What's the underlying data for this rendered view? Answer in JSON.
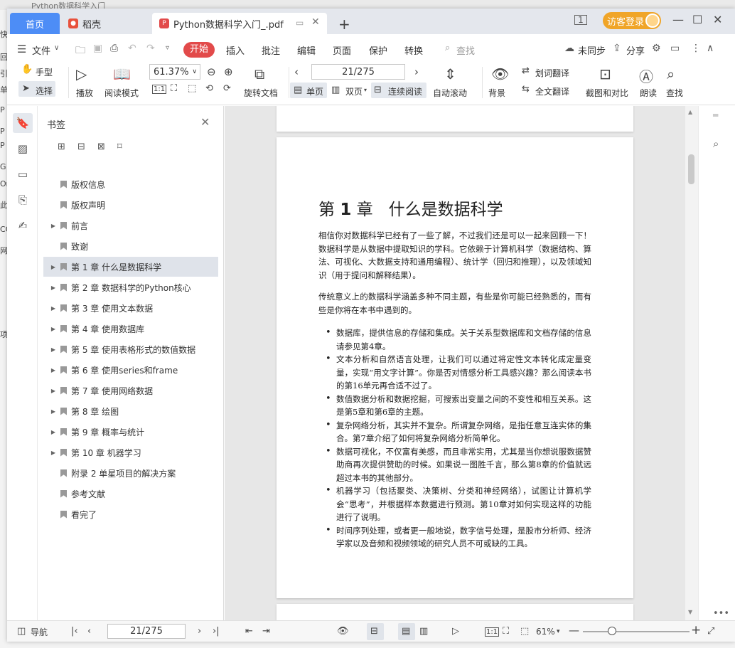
{
  "background": {
    "title": "Python数据科学入门",
    "left_glyphs": [
      "快",
      "回",
      "引",
      "单",
      "P",
      "P",
      "P",
      "G",
      "Or",
      "此",
      "CO",
      "网",
      "项"
    ]
  },
  "tabs": {
    "home": "首页",
    "daoke": "稻壳",
    "pdf": "Python数据科学入门_.pdf",
    "add": "+"
  },
  "account": {
    "login_label": "访客登录"
  },
  "window_controls": {
    "minimize": "—",
    "maximize": "☐",
    "close": "✕"
  },
  "menu": {
    "file": "文件",
    "start": "开始",
    "items": [
      "插入",
      "批注",
      "编辑",
      "页面",
      "保护",
      "转换"
    ],
    "search": "查找",
    "sync": "未同步",
    "share": "分享"
  },
  "ribbon": {
    "hand": "手型",
    "select": "选择",
    "play": "播放",
    "read_mode": "阅读模式",
    "zoom_value": "61.37%",
    "rotate_doc": "旋转文档",
    "page_value": "21/275",
    "single_page": "单页",
    "double_page": "双页",
    "continuous": "连续阅读",
    "auto_scroll": "自动滚动",
    "background": "背景",
    "word_translate": "划词翻译",
    "full_translate": "全文翻译",
    "screenshot_compare": "截图和对比",
    "read_aloud": "朗读",
    "find": "查找"
  },
  "bookmarks": {
    "title": "书签",
    "items": [
      {
        "label": "版权信息",
        "expandable": false,
        "selected": false
      },
      {
        "label": "版权声明",
        "expandable": false,
        "selected": false
      },
      {
        "label": "前言",
        "expandable": true,
        "selected": false
      },
      {
        "label": "致谢",
        "expandable": false,
        "selected": false
      },
      {
        "label": "第 1 章 什么是数据科学",
        "expandable": true,
        "selected": true
      },
      {
        "label": "第 2 章 数据科学的Python核心",
        "expandable": true,
        "selected": false
      },
      {
        "label": "第 3 章 使用文本数据",
        "expandable": true,
        "selected": false
      },
      {
        "label": "第 4 章 使用数据库",
        "expandable": true,
        "selected": false
      },
      {
        "label": "第 5 章 使用表格形式的数值数据",
        "expandable": true,
        "selected": false
      },
      {
        "label": "第 6 章 使用series和frame",
        "expandable": true,
        "selected": false
      },
      {
        "label": "第 7 章 使用网络数据",
        "expandable": true,
        "selected": false
      },
      {
        "label": "第 8 章 绘图",
        "expandable": true,
        "selected": false
      },
      {
        "label": "第 9 章 概率与统计",
        "expandable": true,
        "selected": false
      },
      {
        "label": "第 10 章 机器学习",
        "expandable": true,
        "selected": false
      },
      {
        "label": "附录 2 单星项目的解决方案",
        "expandable": false,
        "selected": false
      },
      {
        "label": "参考文献",
        "expandable": false,
        "selected": false
      },
      {
        "label": "看完了",
        "expandable": false,
        "selected": false
      }
    ]
  },
  "document": {
    "chapter_prefix": "第",
    "chapter_number": "1",
    "chapter_suffix": "章",
    "chapter_title": "什么是数据科学",
    "para1": "相信你对数据科学已经有了一些了解，不过我们还是可以一起来回顾一下！数据科学是从数据中提取知识的学科。它依赖于计算机科学（数据结构、算法、可视化、大数据支持和通用编程）、统计学（回归和推理），以及领域知识（用于提问和解释结果）。",
    "para2": "传统意义上的数据科学涵盖多种不同主题，有些是你可能已经熟悉的，而有些是你将在本书中遇到的。",
    "bullets": [
      "数据库，提供信息的存储和集成。关于关系型数据库和文档存储的信息请参见第4章。",
      "文本分析和自然语言处理，让我们可以通过将定性文本转化成定量变量，实现“用文字计算”。你是否对情感分析工具感兴趣？那么阅读本书的第16单元再合适不过了。",
      "数值数据分析和数据挖掘，可搜索出变量之间的不变性和相互关系。这是第5章和第6章的主题。",
      "复杂网络分析，其实并不复杂。所谓复杂网络，是指任意互连实体的集合。第7章介绍了如何将复杂网络分析简单化。",
      "数据可视化，不仅富有美感，而且非常实用，尤其是当你想说服数据赞助商再次提供赞助的时候。如果说一图胜千言，那么第8章的价值就远超过本书的其他部分。",
      "机器学习（包括聚类、决策树、分类和神经网络），试图让计算机学会“思考”，并根据样本数据进行预测。第10章对如何实现这样的功能进行了说明。",
      "时间序列处理，或者更一般地说，数字信号处理，是股市分析师、经济学家以及音频和视频领域的研究人员不可或缺的工具。"
    ]
  },
  "statusbar": {
    "nav": "导航",
    "page": "21/275",
    "zoom": "61%",
    "zoom_level": 0.27
  },
  "colors": {
    "accent_blue": "#4d8df6",
    "start_red": "#e24a4a",
    "login_orange": "#f0a528",
    "selected_row": "#dfe3ea"
  }
}
